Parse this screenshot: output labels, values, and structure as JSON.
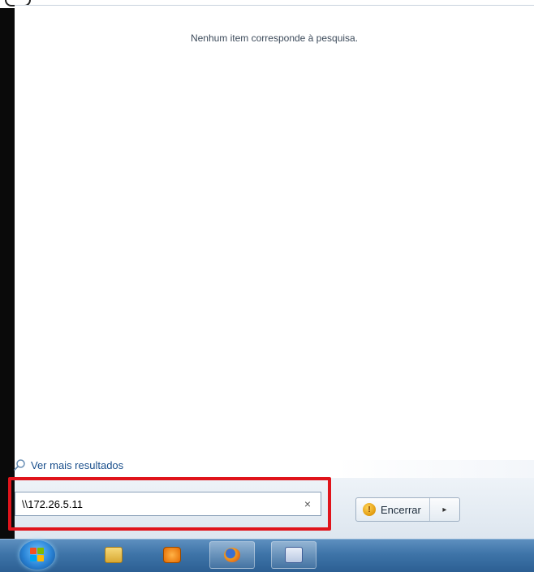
{
  "start_menu": {
    "no_results_text": "Nenhum item corresponde à pesquisa.",
    "see_more_label": "Ver mais resultados",
    "search": {
      "value": "\\\\172.26.5.11",
      "clear_icon": "×"
    },
    "shutdown": {
      "label": "Encerrar",
      "arrow": "▸"
    }
  },
  "taskbar": {
    "items": [
      {
        "name": "windows-explorer",
        "icon": "folder-icon"
      },
      {
        "name": "media-player",
        "icon": "media-player-icon"
      },
      {
        "name": "firefox",
        "icon": "firefox-icon"
      },
      {
        "name": "word",
        "icon": "word-icon"
      }
    ]
  },
  "colors": {
    "highlight": "#e0141b",
    "link": "#1a4f8c",
    "taskbar": "#3e74a8"
  }
}
